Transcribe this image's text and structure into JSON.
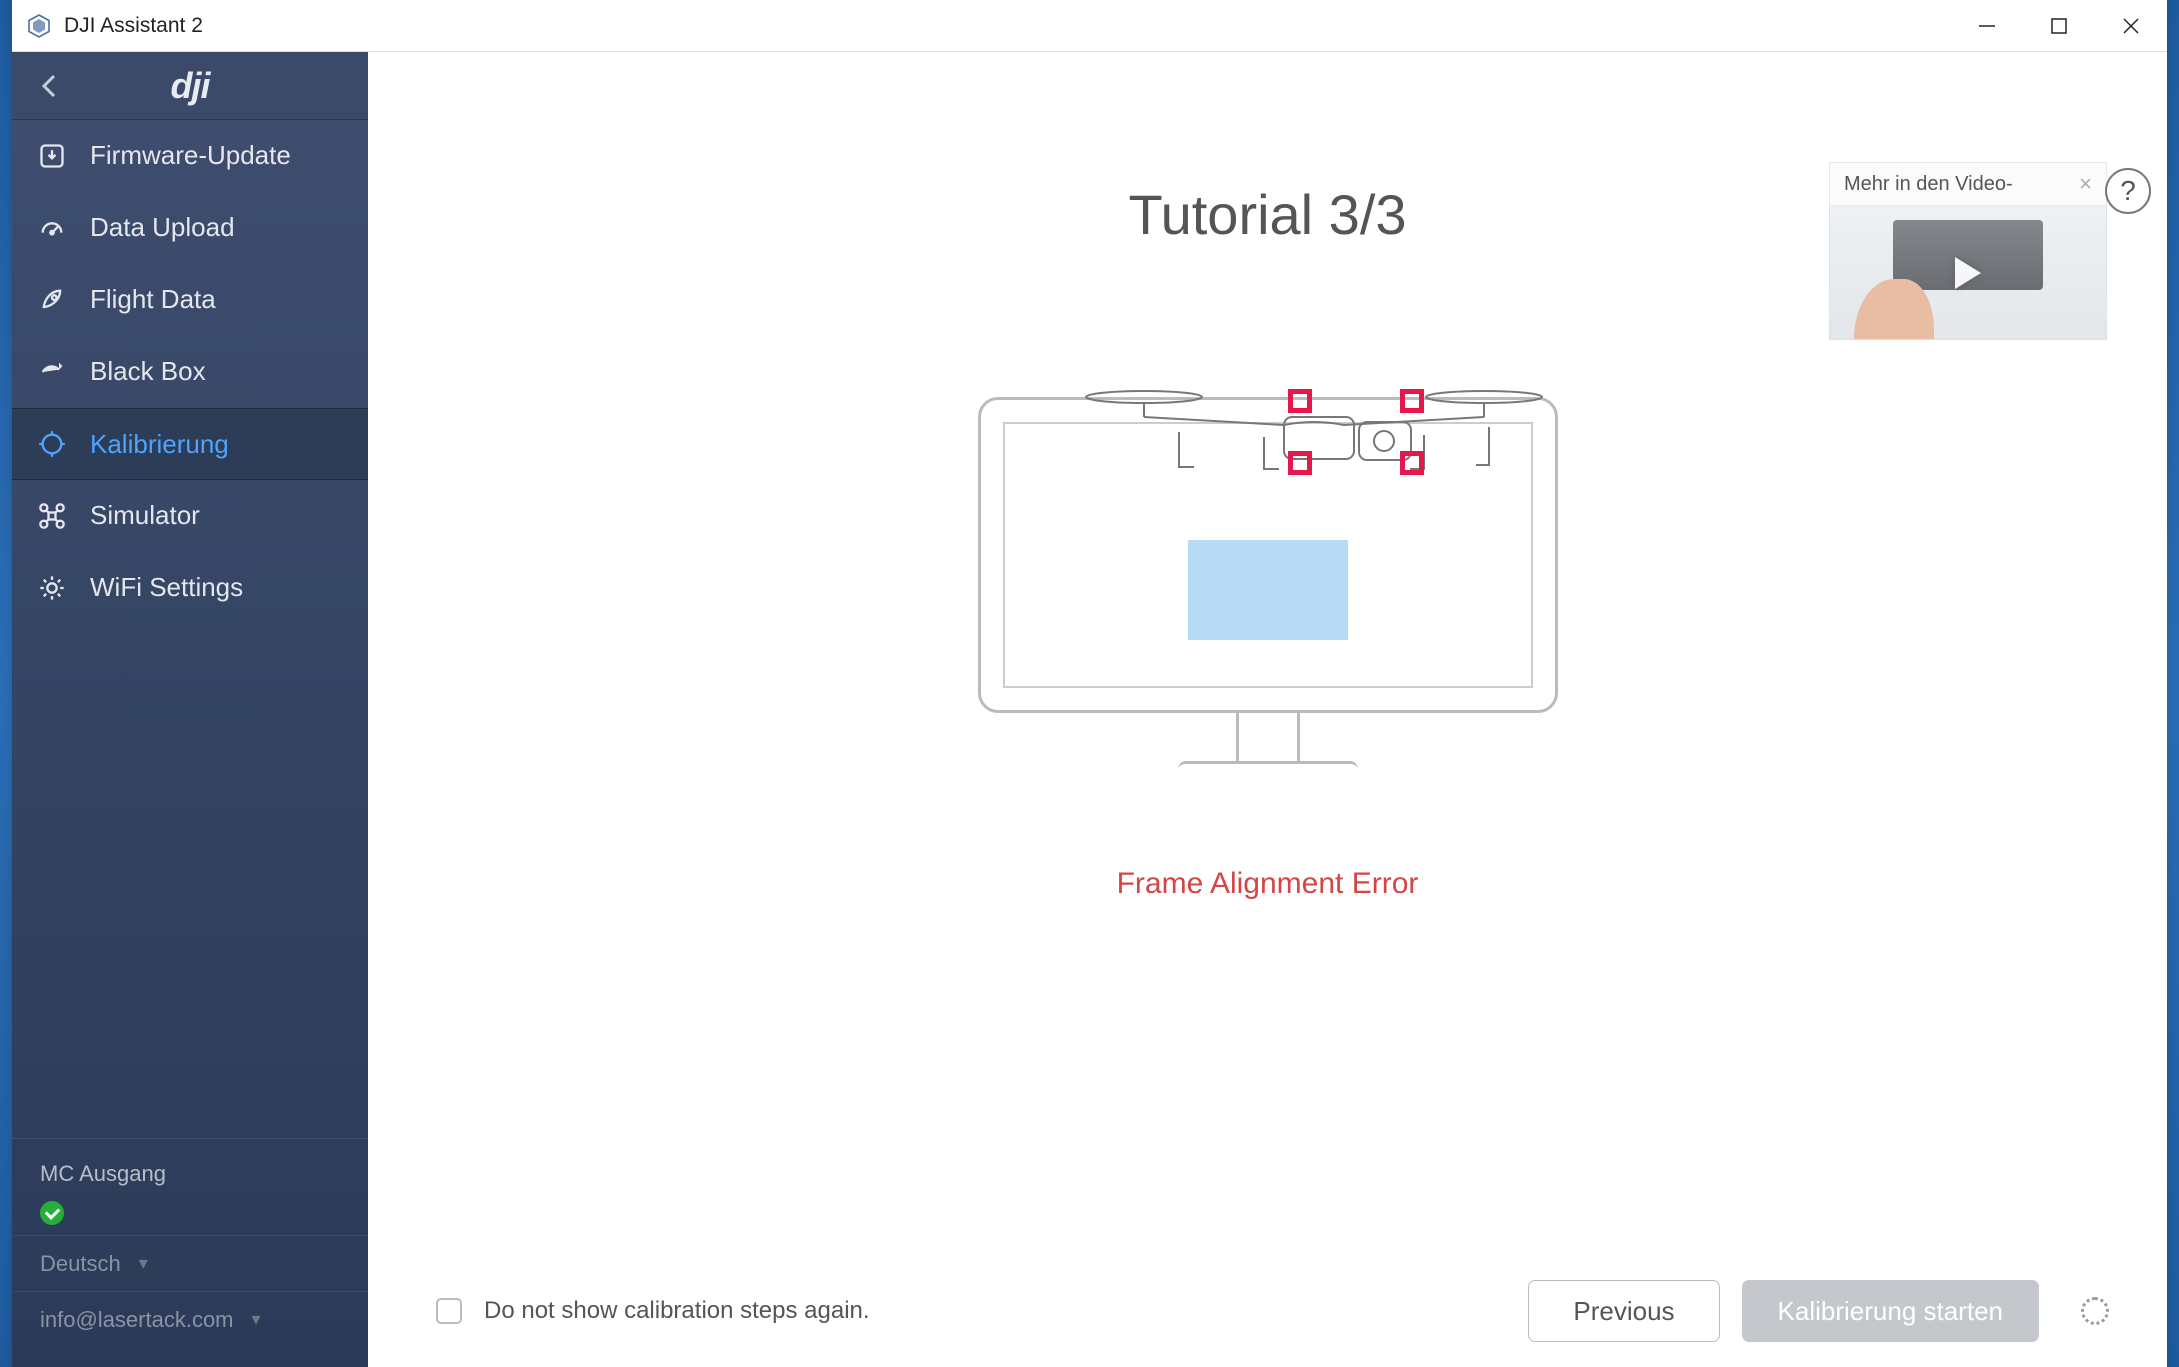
{
  "app": {
    "title": "DJI Assistant 2",
    "logo": "dji"
  },
  "sidebar": {
    "items": [
      {
        "label": "Firmware-Update",
        "icon": "download-chip"
      },
      {
        "label": "Data Upload",
        "icon": "gauge"
      },
      {
        "label": "Flight Data",
        "icon": "rocket"
      },
      {
        "label": "Black Box",
        "icon": "share-arrow"
      },
      {
        "label": "Kalibrierung",
        "icon": "crosshair",
        "active": true
      },
      {
        "label": "Simulator",
        "icon": "drone"
      },
      {
        "label": "WiFi Settings",
        "icon": "gear"
      }
    ],
    "status_label": "MC Ausgang",
    "language": "Deutsch",
    "account": "info@lasertack.com"
  },
  "main": {
    "tutorial_title": "Tutorial 3/3",
    "error_text": "Frame Alignment Error",
    "help_tooltip": "Mehr in den Video-",
    "checkbox_label": "Do not show calibration steps again.",
    "prev_button": "Previous",
    "start_button": "Kalibrierung starten"
  }
}
